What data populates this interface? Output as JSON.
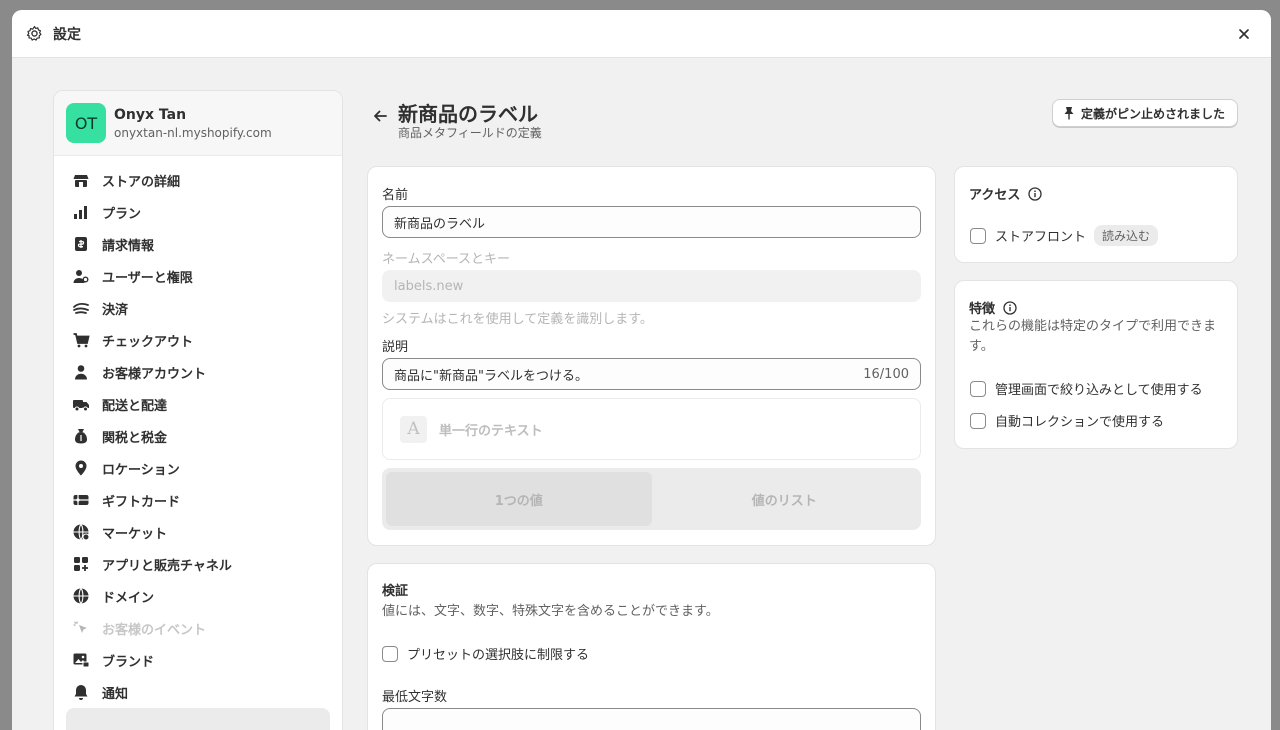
{
  "window": {
    "title": "設定"
  },
  "store": {
    "initials": "OT",
    "name": "Onyx Tan",
    "domain": "onyxtan-nl.myshopify.com"
  },
  "nav": [
    {
      "label": "ストアの詳細",
      "icon": "store-icon"
    },
    {
      "label": "プラン",
      "icon": "plan-icon"
    },
    {
      "label": "請求情報",
      "icon": "billing-icon"
    },
    {
      "label": "ユーザーと権限",
      "icon": "users-icon"
    },
    {
      "label": "決済",
      "icon": "payments-icon"
    },
    {
      "label": "チェックアウト",
      "icon": "cart-icon"
    },
    {
      "label": "お客様アカウント",
      "icon": "person-icon"
    },
    {
      "label": "配送と配達",
      "icon": "truck-icon"
    },
    {
      "label": "関税と税金",
      "icon": "money-bag-icon"
    },
    {
      "label": "ロケーション",
      "icon": "location-pin-icon"
    },
    {
      "label": "ギフトカード",
      "icon": "gift-card-icon"
    },
    {
      "label": "マーケット",
      "icon": "globe-icon"
    },
    {
      "label": "アプリと販売チャネル",
      "icon": "apps-icon"
    },
    {
      "label": "ドメイン",
      "icon": "domain-globe-icon"
    },
    {
      "label": "お客様のイベント",
      "icon": "cursor-click-icon",
      "disabled": true
    },
    {
      "label": "ブランド",
      "icon": "image-icon"
    },
    {
      "label": "通知",
      "icon": "bell-icon"
    }
  ],
  "header": {
    "title": "新商品のラベル",
    "subtitle": "商品メタフィールドの定義",
    "pin_label": "定義がピン止めされました"
  },
  "form": {
    "name_label": "名前",
    "name_value": "新商品のラベル",
    "ns_label": "ネームスペースとキー",
    "ns_value": "labels.new",
    "ns_help": "システムはこれを使用して定義を識別します。",
    "desc_label": "説明",
    "desc_value": "商品に\"新商品\"ラベルをつける。",
    "desc_counter": "16/100",
    "type_label": "単一行のテキスト",
    "type_icon_glyph": "A",
    "seg_single": "1つの値",
    "seg_list": "値のリスト"
  },
  "validation": {
    "title": "検証",
    "desc": "値には、文字、数字、特殊文字を含めることができます。",
    "preset_label": "プリセットの選択肢に制限する",
    "min_label": "最低文字数"
  },
  "access": {
    "title": "アクセス",
    "storefront_label": "ストアフロント",
    "storefront_badge": "読み込む"
  },
  "features": {
    "title": "特徴",
    "desc": "これらの機能は特定のタイプで利用できます。",
    "filter_label": "管理画面で絞り込みとして使用する",
    "collection_label": "自動コレクションで使用する"
  }
}
